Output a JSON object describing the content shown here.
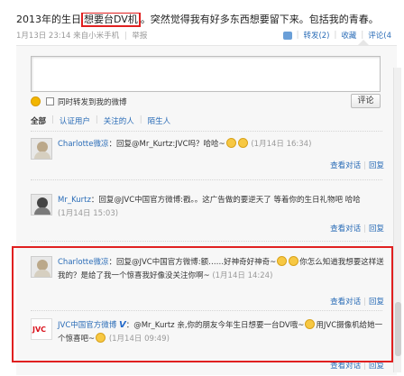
{
  "post": {
    "text_before": "2013年的生日",
    "text_highlight": "想要台DV机",
    "text_after": "。突然觉得我有好多东西想要留下来。包括我的青春。",
    "time": "1月13日 23:14",
    "source": "来自小米手机",
    "report": "举报"
  },
  "actions": {
    "forward": "转发(2)",
    "favorite": "收藏",
    "comment": "评论(4"
  },
  "composer": {
    "placeholder": "",
    "also_forward_label": "同时转发到我的微博",
    "submit_label": "评论"
  },
  "filters": [
    "全部",
    "认证用户",
    "关注的人",
    "陌生人"
  ],
  "comments": [
    {
      "author": "Charlotte微凉",
      "text": "：回复@Mr_Kurtz:JVC吗？哈哈~",
      "time": "(1月14日 16:34)",
      "view": "查看对话",
      "reply": "回复"
    },
    {
      "author": "Mr_Kurtz",
      "text": "：回复@JVC中国官方微博:戳。。这广告做的要逆天了 等着你的生日礼物吧 哈哈",
      "time": "(1月14日 15:03)",
      "view": "查看对话",
      "reply": "回复"
    },
    {
      "author": "Charlotte微凉",
      "text": "：回复@JVC中国官方微博:额……好神奇好神奇~",
      "text2": "你怎么知道我想要这样送我的？是给了我一个惊喜我好像没关注你啊~",
      "time": "(1月14日 14:24)",
      "view": "查看对话",
      "reply": "回复"
    },
    {
      "author": "JVC中国官方微博",
      "text": "：@Mr_Kurtz 亲,你的朋友今年生日想要一台DV哦~",
      "text2": "用JVC摄像机给她一个惊喜吧~",
      "time": "(1月14日 09:49)",
      "view": "查看对话",
      "reply": "回复"
    }
  ],
  "icons": {
    "emoji": "smiley-icon",
    "like": "thumbs-up-icon",
    "verified": "verified-v-icon"
  },
  "colors": {
    "link": "#2a6cb7",
    "highlight_box": "#e02020",
    "jvc_logo": "#d9111b"
  }
}
